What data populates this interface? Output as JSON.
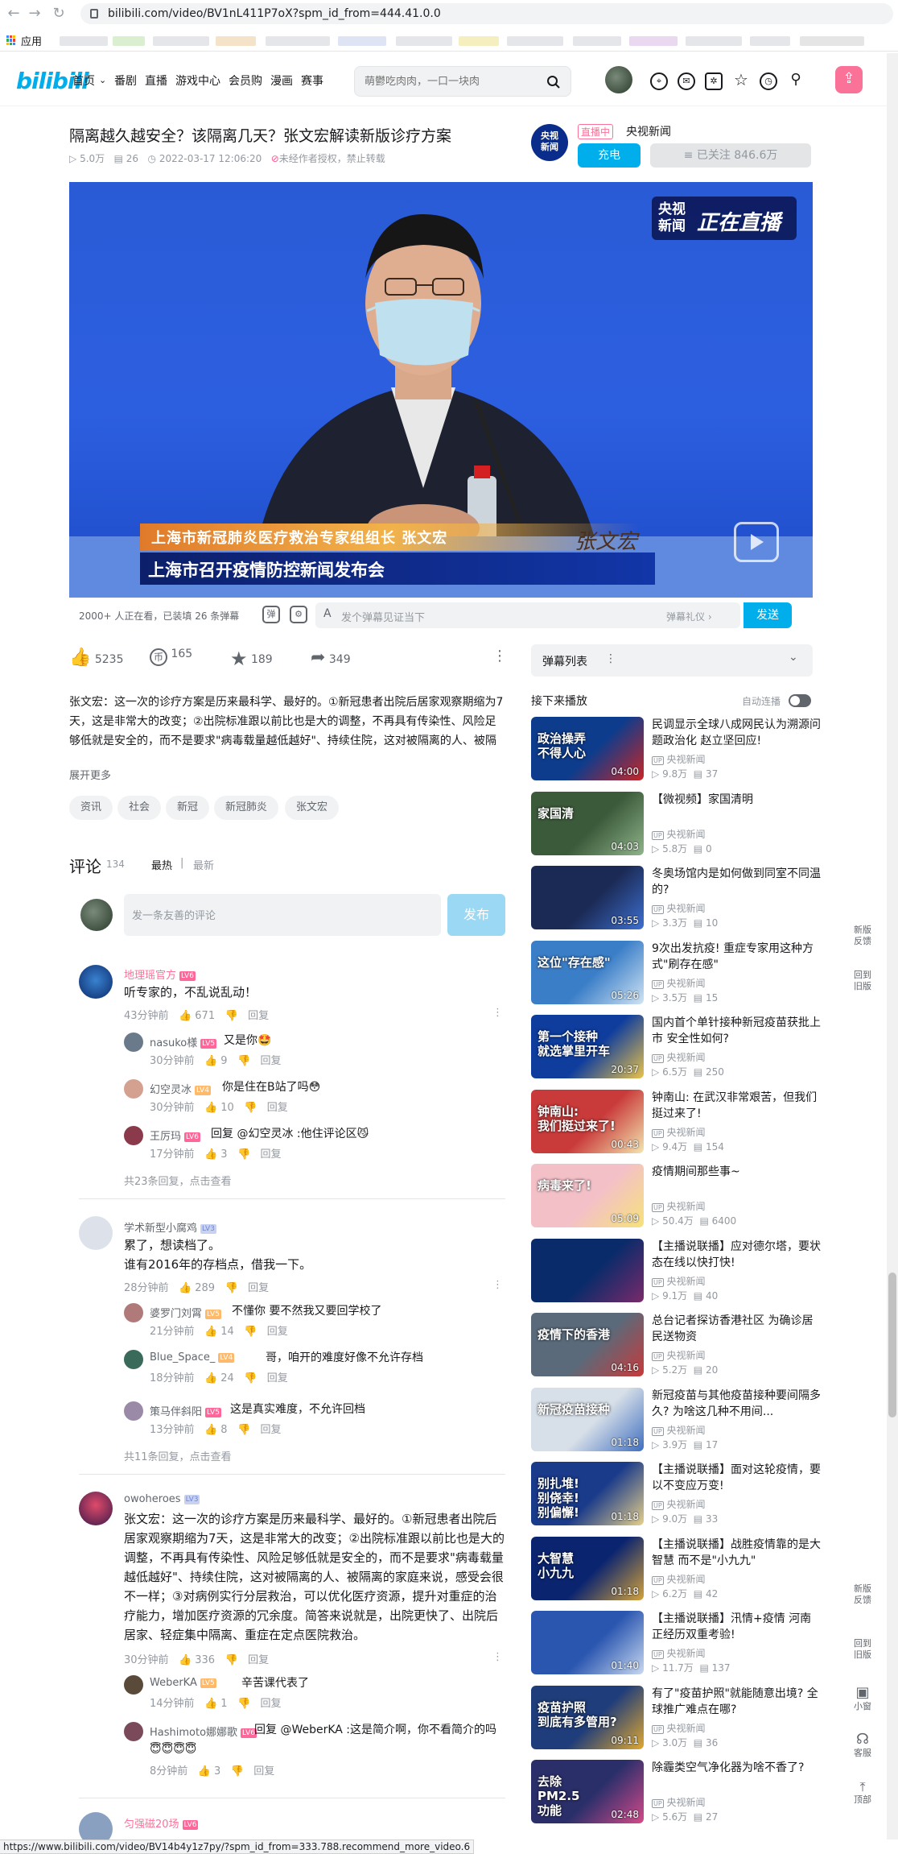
{
  "browser": {
    "url": "bilibili.com/video/BV1nL411P7oX?spm_id_from=444.41.0.0",
    "apps_label": "应用",
    "status_url": "https://www.bilibili.com/video/BV14b4y1z7py/?spm_id_from=333.788.recommend_more_video.6"
  },
  "header": {
    "logo": "bilibili",
    "nav": [
      "首页",
      "番剧",
      "直播",
      "游戏中心",
      "会员购",
      "漫画",
      "赛事"
    ],
    "search_placeholder": "萌鬱吃肉肉，一口一块肉"
  },
  "video": {
    "title": "隔离越久越安全？该隔离几天？张文宏解读新版诊疗方案",
    "views": "5.0万",
    "danmaku_count": "26",
    "date": "2022-03-17 12:06:20",
    "copyright": "未经作者授权，禁止转载",
    "lower_third_name": "上海市新冠肺炎医疗救治专家组组长 张文宏",
    "lower_third_event": "上海市召开疫情防控新闻发布会",
    "signature": "张文宏",
    "channel_bug_1": "央视",
    "channel_bug_2": "新闻",
    "live_label": "正在直播"
  },
  "danmaku": {
    "watching": "2000+ 人正在看，已装填 26 条弹幕",
    "input_placeholder": "发个弹幕见证当下",
    "etiquette": "弹幕礼仪 ›",
    "send": "发送"
  },
  "actions": {
    "like": "5235",
    "coin": "165",
    "fav": "189",
    "share": "349"
  },
  "description": {
    "text": "张文宏：这一次的诊疗方案是历来最科学、最好的。①新冠患者出院后居家观察期缩为7天，这是非常大的改变；②出院标准跟以前比也是大的调整，不再具有传染性、风险足够低就是安全的，而不是要求\"病毒载量越低越好\"、持续住院，这对被隔离的人、被隔离的家庭来说，感受会很不一样；③对病例实行分层救治，可以优化",
    "expand": "展开更多",
    "tags": [
      "资讯",
      "社会",
      "新冠",
      "新冠肺炎",
      "张文宏"
    ]
  },
  "comments": {
    "heading": "评论",
    "count": "134",
    "sort_hot": "最热",
    "sort_new": "最新",
    "input_placeholder": "发一条友善的评论",
    "post": "发布",
    "reply_label": "回复",
    "items": [
      {
        "name": "地理瑶官方",
        "level": "LV6",
        "text": "听专家的，不乱说乱动！",
        "time": "43分钟前",
        "likes": "671",
        "replies": [
          {
            "name": "nasuko様",
            "level": "LV5",
            "text": "又是你🤩",
            "time": "30分钟前",
            "likes": "9"
          },
          {
            "name": "幻空灵冰",
            "level": "LV4",
            "text": "你是住在B站了吗😳",
            "time": "30分钟前",
            "likes": "10"
          },
          {
            "name": "王厉玛",
            "level": "LV6",
            "text": "回复 @幻空灵冰 :他住评论区😼",
            "time": "17分钟前",
            "likes": "3"
          }
        ],
        "more": "共23条回复，点击查看"
      },
      {
        "name": "学术新型小腐鸡",
        "level": "LV3",
        "text": "累了，想读档了。\n谁有2016年的存档点，借我一下。",
        "time": "28分钟前",
        "likes": "289",
        "replies": [
          {
            "name": "婆罗门刘霄",
            "level": "LV5",
            "text": "不懂你 要不然我又要回学校了",
            "time": "21分钟前",
            "likes": "14"
          },
          {
            "name": "Blue_Space_",
            "level": "LV4",
            "text": "哥，咱开的难度好像不允许存档",
            "time": "18分钟前",
            "likes": "24"
          },
          {
            "name": "策马伴斜阳",
            "level": "LV5",
            "text": "这是真实难度，不允许回档",
            "time": "13分钟前",
            "likes": "8"
          }
        ],
        "more": "共11条回复，点击查看"
      },
      {
        "name": "owoheroes",
        "level": "LV3",
        "text": "张文宏：这一次的诊疗方案是历来最科学、最好的。①新冠患者出院后居家观察期缩为7天，这是非常大的改变；②出院标准跟以前比也是大的调整，不再具有传染性、风险足够低就是安全的，而不是要求\"病毒载量越低越好\"、持续住院，这对被隔离的人、被隔离的家庭来说，感受会很不一样；③对病例实行分层救治，可以优化医疗资源，提升对重症的治疗能力，增加医疗资源的冗余度。简答来说就是，出院更快了、出院后居家、轻症集中隔离、重症在定点医院救治。",
        "time": "30分钟前",
        "likes": "336",
        "replies": [
          {
            "name": "WeberKA",
            "level": "LV5",
            "text": "辛苦课代表了",
            "time": "14分钟前",
            "likes": "1"
          },
          {
            "name": "Hashimoto娜娜歌",
            "level": "LV6",
            "text": "回复 @WeberKA :这是简介啊，你不看简介的吗😇😇😇😇",
            "time": "8分钟前",
            "likes": "3"
          }
        ]
      },
      {
        "name": "匀强磁20场",
        "level": "LV6"
      }
    ]
  },
  "uploader": {
    "live_badge": "直播中",
    "name": "央视新闻",
    "charge": "充电",
    "follow": "≡ 已关注 846.6万",
    "avatar_text": "央视\n新闻"
  },
  "danmaku_list": {
    "label": "弹幕列表",
    "more": "⋮"
  },
  "recommend": {
    "heading": "接下来播放",
    "autoplay": "自动连播",
    "items": [
      {
        "title": "民调显示全球八成网民认为溯源问题政治化 赵立坚回应!",
        "up": "央视新闻",
        "views": "9.8万",
        "dm": "37",
        "dur": "04:00",
        "thumb_text": "政治操弄\n不得人心",
        "c1": "#0d3c8c",
        "c2": "#c92626"
      },
      {
        "title": "【微视频】家国清明",
        "up": "央视新闻",
        "views": "5.8万",
        "dm": "0",
        "dur": "04:03",
        "thumb_text": "家国清",
        "c1": "#3b5a3a",
        "c2": "#8fb38a"
      },
      {
        "title": "冬奥场馆内是如何做到同室不同温的?",
        "up": "央视新闻",
        "views": "3.3万",
        "dm": "10",
        "dur": "03:55",
        "thumb_text": "",
        "c1": "#1b2a55",
        "c2": "#3d6fd0"
      },
      {
        "title": "9次出发抗疫! 重症专家用这种方式\"刷存在感\"",
        "up": "央视新闻",
        "views": "3.5万",
        "dm": "15",
        "dur": "05:26",
        "thumb_text": "这位\"存在感\"",
        "c1": "#3b7ec8",
        "c2": "#d0e4f4"
      },
      {
        "title": "国内首个单针接种新冠疫苗获批上市 安全性如何?",
        "up": "央视新闻",
        "views": "6.5万",
        "dm": "250",
        "dur": "20:37",
        "thumb_text": "第一个接种\n就选掌里开车",
        "c1": "#0e3d9e",
        "c2": "#e8c24a"
      },
      {
        "title": "钟南山: 在武汉非常艰苦，但我们挺过来了!",
        "up": "央视新闻",
        "views": "9.4万",
        "dm": "154",
        "dur": "00:43",
        "thumb_text": "钟南山:\n我们挺过来了!",
        "c1": "#c93a3a",
        "c2": "#f3e6b0"
      },
      {
        "title": "疫情期间那些事~",
        "up": "央视新闻",
        "views": "50.4万",
        "dm": "6400",
        "dur": "05:09",
        "thumb_text": "病毒来了!",
        "c1": "#f3c0c8",
        "c2": "#f7e27a"
      },
      {
        "title": "【主播说联播】应对德尔塔，要状态在线以快打快!",
        "up": "央视新闻",
        "views": "9.1万",
        "dm": "40",
        "dur": "",
        "thumb_text": "",
        "c1": "#0a2b6a",
        "c2": "#7a2a6a"
      },
      {
        "title": "总台记者探访香港社区 为确诊居民送物资",
        "up": "央视新闻",
        "views": "5.2万",
        "dm": "20",
        "dur": "04:16",
        "thumb_text": "疫情下的香港",
        "c1": "#5a6a7a",
        "c2": "#c83a3a"
      },
      {
        "title": "新冠疫苗与其他疫苗接种要间隔多久? 为啥这几种不用间...",
        "up": "央视新闻",
        "views": "3.9万",
        "dm": "17",
        "dur": "01:18",
        "thumb_text": "新冠疫苗接种",
        "c1": "#d7dfe8",
        "c2": "#3f6fc0"
      },
      {
        "title": "【主播说联播】面对这轮疫情，要以不变应万变!",
        "up": "央视新闻",
        "views": "9.0万",
        "dm": "33",
        "dur": "01:18",
        "thumb_text": "别扎堆!\n别侥幸!\n别偏懈!",
        "c1": "#1a3a8a",
        "c2": "#e6d08a"
      },
      {
        "title": "【主播说联播】战胜疫情靠的是大智慧 而不是\"小九九\"",
        "up": "央视新闻",
        "views": "6.2万",
        "dm": "42",
        "dur": "01:18",
        "thumb_text": "大智慧\n小九九",
        "c1": "#0a2470",
        "c2": "#d4a23a"
      },
      {
        "title": "【主播说联播】汛情+疫情 河南正经历双重考验!",
        "up": "央视新闻",
        "views": "11.7万",
        "dm": "137",
        "dur": "01:40",
        "thumb_text": "",
        "c1": "#2a56b0",
        "c2": "#c8d8f0"
      },
      {
        "title": "有了\"疫苗护照\"就能随意出境? 全球推广难点在哪?",
        "up": "央视新闻",
        "views": "3.0万",
        "dm": "36",
        "dur": "09:11",
        "thumb_text": "疫苗护照\n到底有多管用?",
        "c1": "#1f3d7a",
        "c2": "#e0a830"
      },
      {
        "title": "除霾类空气净化器为啥不香了?",
        "up": "央视新闻",
        "views": "5.6万",
        "dm": "27",
        "dur": "02:48",
        "thumb_text": "去除\nPM2.5\n功能",
        "c1": "#2a2f6a",
        "c2": "#d44a8a"
      }
    ]
  },
  "sidebar": {
    "feedback": "新版\n反馈",
    "old": "回到\n旧版",
    "feedback2": "新版\n反馈",
    "old2": "回到\n旧版",
    "mini": "小窗",
    "service": "客服",
    "top": "顶部"
  },
  "colors": {
    "brand": "#00aeec",
    "pink": "#fb7299",
    "blue": "#1340b8"
  }
}
